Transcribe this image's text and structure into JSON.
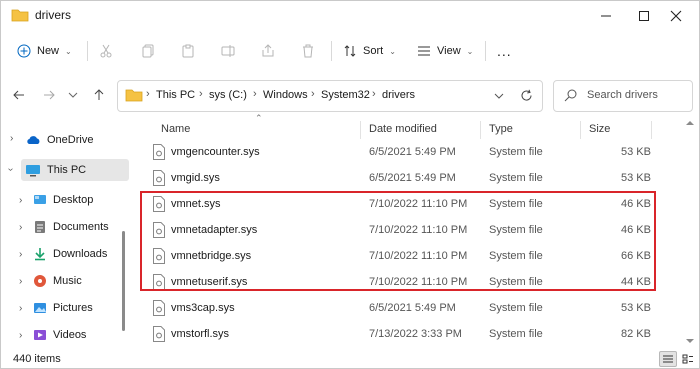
{
  "window": {
    "title": "drivers"
  },
  "commands": {
    "new": "New",
    "sort": "Sort",
    "view": "View",
    "more": "..."
  },
  "address": {
    "crumbs": [
      "This PC",
      "sys (C:)",
      "Windows",
      "System32",
      "drivers"
    ],
    "search_placeholder": "Search drivers"
  },
  "nav": {
    "items": [
      "OneDrive",
      "This PC",
      "Desktop",
      "Documents",
      "Downloads",
      "Music",
      "Pictures",
      "Videos"
    ]
  },
  "table": {
    "headers": {
      "name": "Name",
      "date": "Date modified",
      "type": "Type",
      "size": "Size"
    },
    "rows": [
      {
        "name": "vmgencounter.sys",
        "date": "6/5/2021 5:49 PM",
        "type": "System file",
        "size": "53 KB"
      },
      {
        "name": "vmgid.sys",
        "date": "6/5/2021 5:49 PM",
        "type": "System file",
        "size": "53 KB"
      },
      {
        "name": "vmnet.sys",
        "date": "7/10/2022 11:10 PM",
        "type": "System file",
        "size": "46 KB"
      },
      {
        "name": "vmnetadapter.sys",
        "date": "7/10/2022 11:10 PM",
        "type": "System file",
        "size": "46 KB"
      },
      {
        "name": "vmnetbridge.sys",
        "date": "7/10/2022 11:10 PM",
        "type": "System file",
        "size": "66 KB"
      },
      {
        "name": "vmnetuserif.sys",
        "date": "7/10/2022 11:10 PM",
        "type": "System file",
        "size": "44 KB"
      },
      {
        "name": "vms3cap.sys",
        "date": "6/5/2021 5:49 PM",
        "type": "System file",
        "size": "53 KB"
      },
      {
        "name": "vmstorfl.sys",
        "date": "7/13/2022 3:33 PM",
        "type": "System file",
        "size": "82 KB"
      }
    ]
  },
  "status": {
    "items_count": "440 items"
  },
  "colors": {
    "accent": "#0067c0",
    "folder": "#f5c243",
    "highlight": "#d9252a"
  }
}
